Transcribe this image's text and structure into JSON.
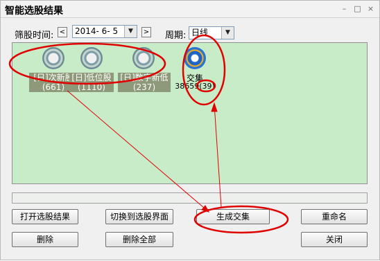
{
  "window": {
    "title": "智能选股结果",
    "controls": {
      "minimize": "–",
      "maximize": "□",
      "close": "×"
    }
  },
  "filter": {
    "date_label": "筛股时间:",
    "prev": "<",
    "date_value": "2014- 6- 5",
    "next": ">",
    "period_label": "周期:",
    "period_value": "日线",
    "dropdown_arrow": "▼"
  },
  "results": [
    {
      "label": "[日]次新股",
      "count": "(661)",
      "icon": "gray-ring-icon"
    },
    {
      "label": "[日]低位股",
      "count": "(1110)",
      "icon": "gray-ring-icon"
    },
    {
      "label": "[日]数字新低",
      "count": "(237)",
      "icon": "gray-ring-icon"
    },
    {
      "label": "交集",
      "count": "38659(39)",
      "icon": "blue-ring-icon",
      "selected": true
    }
  ],
  "buttons": {
    "open_result": "打开选股结果",
    "switch_screen": "切换到选股界面",
    "generate_intersection": "生成交集",
    "rename": "重命名",
    "delete": "删除",
    "delete_all": "删除全部",
    "close": "关闭"
  },
  "annotation_color": "#e00000"
}
